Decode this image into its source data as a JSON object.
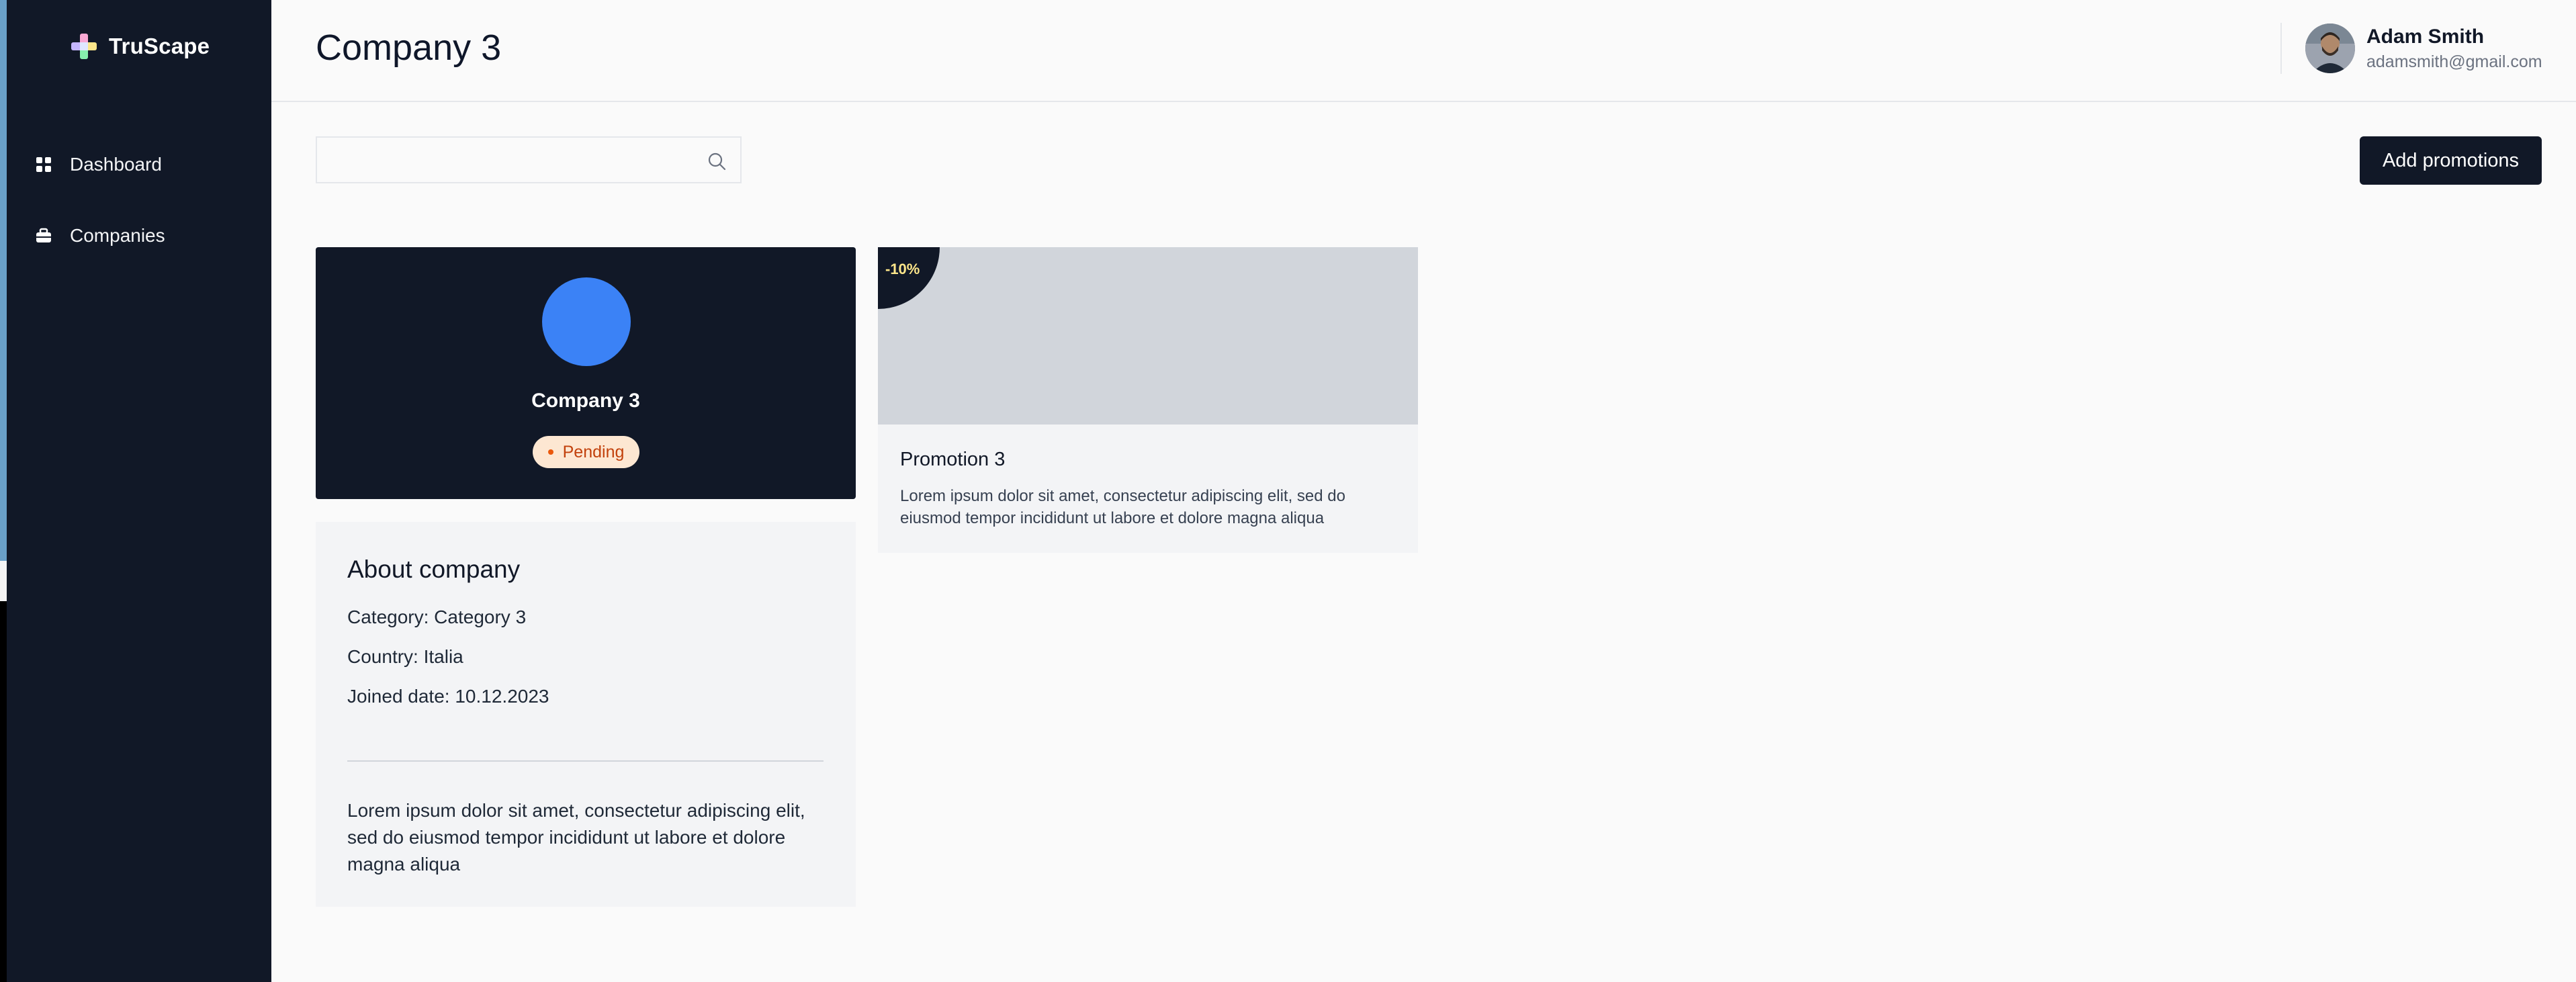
{
  "app": {
    "name": "TruScape"
  },
  "sidebar": {
    "items": [
      {
        "label": "Dashboard",
        "icon": "grid-icon"
      },
      {
        "label": "Companies",
        "icon": "briefcase-icon"
      }
    ]
  },
  "header": {
    "title": "Company 3",
    "user": {
      "name": "Adam Smith",
      "email": "adamsmith@gmail.com"
    }
  },
  "search": {
    "value": "",
    "placeholder": ""
  },
  "actions": {
    "add_label": "Add promotions"
  },
  "company": {
    "name": "Company 3",
    "status": "Pending",
    "status_color": "#c2410c",
    "logo_color": "#3b82f6"
  },
  "about": {
    "title": "About company",
    "category": "Category: Category 3",
    "country": "Country: Italia",
    "joined": "Joined date: 10.12.2023",
    "description": "Lorem ipsum dolor sit amet, consectetur adipiscing elit, sed do eiusmod tempor incididunt ut labore et dolore magna aliqua"
  },
  "promotions": [
    {
      "discount": "-10%",
      "title": "Promotion 3",
      "description": "Lorem ipsum dolor sit amet, consectetur adipiscing elit, sed do eiusmod tempor incididunt ut labore et dolore magna aliqua"
    }
  ],
  "colors": {
    "sidebar_bg": "#111827",
    "accent": "#111827",
    "badge_text": "#fde68a"
  }
}
